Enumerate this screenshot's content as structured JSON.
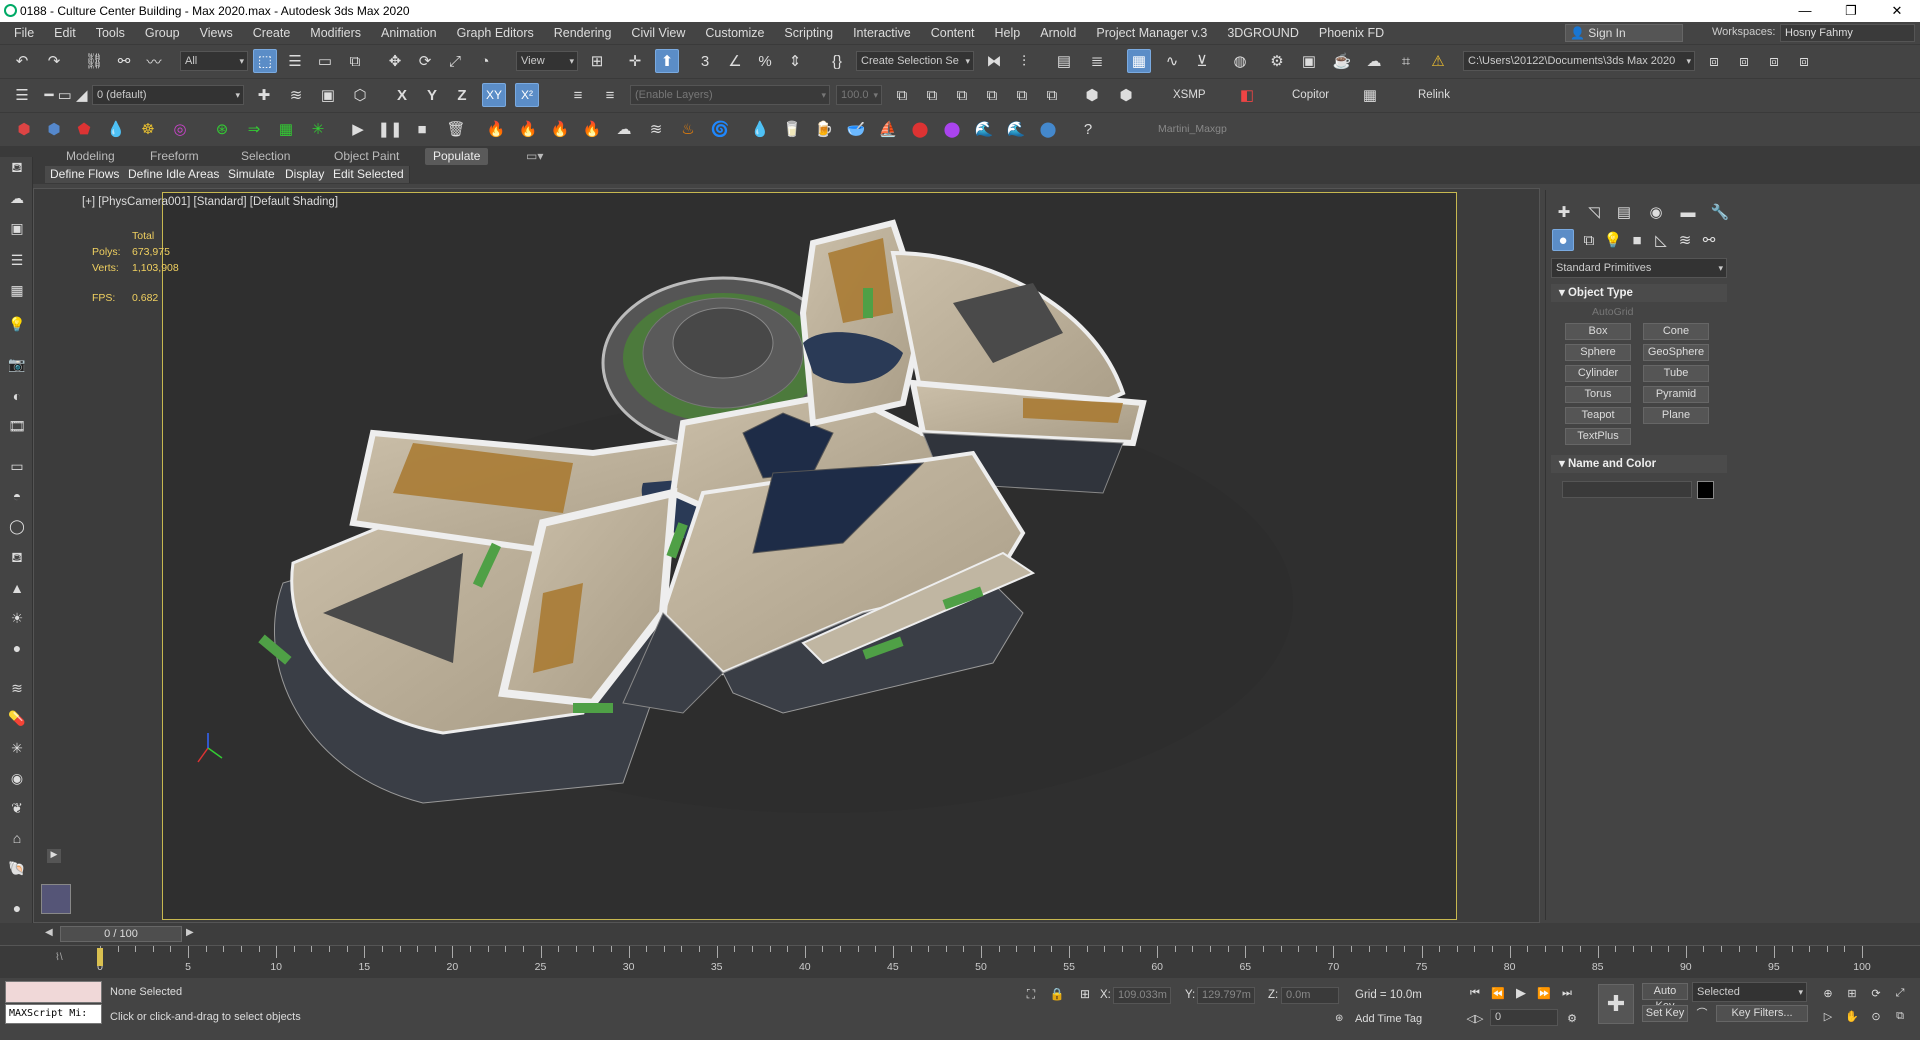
{
  "window": {
    "title": "0188 - Culture Center Building - Max 2020.max - Autodesk 3ds Max 2020",
    "minimize": "—",
    "maximize": "❐",
    "close": "✕"
  },
  "menu": {
    "items": [
      "File",
      "Edit",
      "Tools",
      "Group",
      "Views",
      "Create",
      "Modifiers",
      "Animation",
      "Graph Editors",
      "Rendering",
      "Civil View",
      "Customize",
      "Scripting",
      "Interactive",
      "Content",
      "Help",
      "Arnold",
      "Project Manager v.3",
      "3DGROUND",
      "Phoenix FD"
    ],
    "signin": "Sign In",
    "workspaces_label": "Workspaces:",
    "workspace_value": "Hosny Fahmy"
  },
  "toolbar1": {
    "filter_value": "All",
    "refcoord_value": "View",
    "selection_set_placeholder": "Create Selection Se",
    "project_path": "C:\\Users\\20122\\Documents\\3ds Max 2020"
  },
  "toolbar2": {
    "layer_value": "0 (default)",
    "axes": [
      "X",
      "Y",
      "Z",
      "XY",
      "X²"
    ],
    "enable_layers": "(Enable Layers)",
    "spinner_value": "100.0",
    "xsmp": "XSMP",
    "copitor": "Copitor",
    "relink": "Relink"
  },
  "toolbar3": {
    "script_label": "Martini_Maxgp"
  },
  "ribbon": {
    "tabs": [
      "Modeling",
      "Freeform",
      "Selection",
      "Object Paint",
      "Populate"
    ],
    "active_tab": "Populate",
    "subtabs": [
      "Define Flows",
      "Define Idle Areas",
      "Simulate",
      "Display",
      "Edit Selected"
    ]
  },
  "viewport": {
    "label": "[+] [PhysCamera001] [Standard] [Default Shading]",
    "stats": {
      "total_label": "Total",
      "polys_label": "Polys:",
      "polys_value": "673,975",
      "verts_label": "Verts:",
      "verts_value": "1,103,908",
      "fps_label": "FPS:",
      "fps_value": "0.682"
    }
  },
  "command_panel": {
    "category": "Standard Primitives",
    "object_type_title": "Object Type",
    "autogrid": "AutoGrid",
    "buttons": [
      "Box",
      "Cone",
      "Sphere",
      "GeoSphere",
      "Cylinder",
      "Tube",
      "Torus",
      "Pyramid",
      "Teapot",
      "Plane",
      "TextPlus"
    ],
    "name_color_title": "Name and Color",
    "swatch_color": "#000000"
  },
  "timeline": {
    "slider_value": "0 / 100",
    "ticks": [
      0,
      5,
      10,
      15,
      20,
      25,
      30,
      35,
      40,
      45,
      50,
      55,
      60,
      65,
      70,
      75,
      80,
      85,
      90,
      95,
      100
    ]
  },
  "status": {
    "maxscript": "MAXScript Mi:",
    "selection": "None Selected",
    "prompt": "Click or click-and-drag to select objects",
    "x_label": "X:",
    "x_value": "109.033m",
    "y_label": "Y:",
    "y_value": "129.797m",
    "z_label": "Z:",
    "z_value": "0.0m",
    "grid": "Grid = 10.0m",
    "add_time_tag": "Add Time Tag",
    "autokey": "Auto Key",
    "setkey": "Set Key",
    "selected": "Selected",
    "frame_value": "0",
    "key_filters": "Key Filters..."
  },
  "colors": {
    "accent": "#5b8dc7",
    "viewport_border": "#c7b850",
    "stats_text": "#f0d060"
  }
}
